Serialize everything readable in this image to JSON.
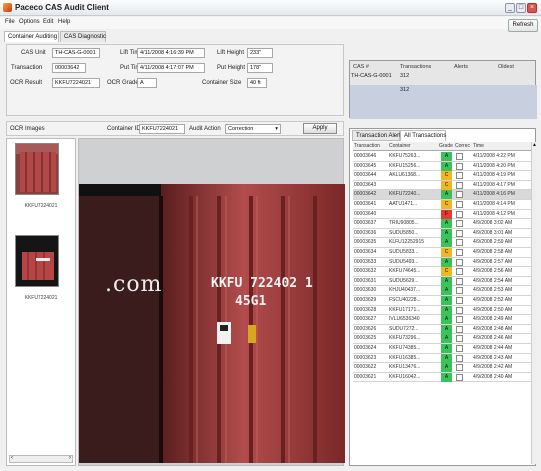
{
  "window": {
    "title": "Paceco CAS Audit Client",
    "min": "_",
    "max": "□",
    "close": "×"
  },
  "menu": [
    {
      "label": "File"
    },
    {
      "label": "Options"
    },
    {
      "label": "Edit"
    },
    {
      "label": "Help"
    }
  ],
  "refresh_label": "Refresh",
  "tabs": [
    {
      "label": "Container Auditing"
    },
    {
      "label": "CAS Diagnostic"
    }
  ],
  "form": {
    "cas_unit_label": "CAS Unit",
    "cas_unit": "TH-CAS-G-0001",
    "transaction_label": "Transaction",
    "transaction": "00003642",
    "ocr_result_label": "OCR Result",
    "ocr_result": "KKFU7224021",
    "lift_time_label": "Lift Time",
    "lift_time": "4/11/2008 4:16:39 PM",
    "put_time_label": "Put Time",
    "put_time": "4/11/2008 4:17:07 PM",
    "ocr_grade_label": "OCR Grade",
    "ocr_grade": "A",
    "lift_height_label": "Lift Height",
    "lift_height": "233\"",
    "put_height_label": "Put Height",
    "put_height": "178\"",
    "container_size_label": "Container Size",
    "container_size": "40 ft"
  },
  "cas_table": {
    "headers": [
      "CAS #",
      "Transactions",
      "Alerts",
      "Oldest"
    ],
    "unit": "TH-CAS-G-0001",
    "transactions_1": "312",
    "transactions_2": "312"
  },
  "ocr_bar": {
    "title": "OCR Images",
    "container_id_label": "Container ID",
    "container_id": "KKFU7224021",
    "audit_action_label": "Audit Action",
    "audit_action": "Correction",
    "apply_label": "Apply"
  },
  "thumbnails": [
    {
      "label": "KKFU7224021"
    },
    {
      "label": "KKFU7224021"
    }
  ],
  "photo": {
    "text_com": ".com",
    "code_line1": "KKFU 722402 1",
    "code_line2": "45G1"
  },
  "right_tabs": [
    {
      "label": "Transaction Alerts"
    },
    {
      "label": "All Transactions"
    }
  ],
  "grid_headers": [
    "Transaction",
    "Container",
    "Grade",
    "Correc",
    "Time"
  ],
  "grade_colors": {
    "A": "#3cc25a",
    "C": "#f2b624",
    "F": "#e53935"
  },
  "rows": [
    {
      "t": "00003646",
      "c": "KKFU75263...",
      "g": "A",
      "time": "4/11/2008 4:22 PM"
    },
    {
      "t": "00003645",
      "c": "KKFU15256...",
      "g": "A",
      "time": "4/11/2008 4:20 PM"
    },
    {
      "t": "00003644",
      "c": "AKLU61368...",
      "g": "C",
      "time": "4/11/2008 4:19 PM"
    },
    {
      "t": "00003643",
      "c": "",
      "g": "C",
      "time": "4/11/2008 4:17 PM"
    },
    {
      "t": "00003642",
      "c": "KKFU72240...",
      "g": "A",
      "time": "4/11/2008 4:16 PM"
    },
    {
      "t": "00003641",
      "c": "AATU1471...",
      "g": "C",
      "time": "4/11/2008 4:14 PM"
    },
    {
      "t": "00003640",
      "c": "",
      "g": "F",
      "time": "4/11/2008 4:12 PM"
    },
    {
      "t": "00003637",
      "c": "TRIU90805...",
      "g": "A",
      "time": "4/9/2008 3:02 AM"
    },
    {
      "t": "00003636",
      "c": "SUDU5850...",
      "g": "A",
      "time": "4/9/2008 3:01 AM"
    },
    {
      "t": "00003635",
      "c": "KLFU12252915",
      "g": "A",
      "time": "4/9/2008 2:59 AM"
    },
    {
      "t": "00003634",
      "c": "SUDU5833...",
      "g": "C",
      "time": "4/9/2008 2:58 AM"
    },
    {
      "t": "00003633",
      "c": "SUDU5493...",
      "g": "A",
      "time": "4/9/2008 2:57 AM"
    },
    {
      "t": "00003632",
      "c": "KKFU74645...",
      "g": "C",
      "time": "4/9/2008 2:56 AM"
    },
    {
      "t": "00003631",
      "c": "SUDU5629...",
      "g": "A",
      "time": "4/9/2008 2:54 AM"
    },
    {
      "t": "00003630",
      "c": "KHJU40437...",
      "g": "A",
      "time": "4/9/2008 2:53 AM"
    },
    {
      "t": "00003629",
      "c": "FSCU40228...",
      "g": "A",
      "time": "4/9/2008 2:52 AM"
    },
    {
      "t": "00003628",
      "c": "KKFU17171...",
      "g": "A",
      "time": "4/9/2008 2:50 AM"
    },
    {
      "t": "00003627",
      "c": "IVLU6536340",
      "g": "A",
      "time": "4/9/2008 2:49 AM"
    },
    {
      "t": "00003626",
      "c": "SUDU7272...",
      "g": "A",
      "time": "4/9/2008 2:48 AM"
    },
    {
      "t": "00003625",
      "c": "KKFU73296...",
      "g": "A",
      "time": "4/9/2008 2:46 AM"
    },
    {
      "t": "00003624",
      "c": "KKFU74385...",
      "g": "A",
      "time": "4/9/2008 2:44 AM"
    },
    {
      "t": "00003623",
      "c": "KKFU16385...",
      "g": "A",
      "time": "4/9/2008 2:43 AM"
    },
    {
      "t": "00003622",
      "c": "KKFU13476...",
      "g": "A",
      "time": "4/9/2008 2:42 AM"
    },
    {
      "t": "00003621",
      "c": "KKFU16042...",
      "g": "A",
      "time": "4/9/2008 2:40 AM"
    }
  ]
}
